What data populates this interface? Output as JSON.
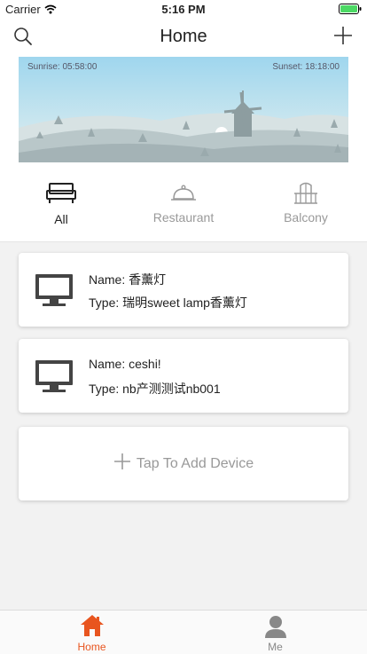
{
  "status_bar": {
    "carrier": "Carrier",
    "time": "5:16 PM"
  },
  "header": {
    "title": "Home",
    "icons": [
      "search-icon",
      "plus-icon"
    ]
  },
  "banner": {
    "sunrise": "Sunrise: 05:58:00",
    "sunset": "Sunset: 18:18:00"
  },
  "tabs": [
    {
      "label": "All",
      "icon": "sofa-icon",
      "active": true
    },
    {
      "label": "Restaurant",
      "icon": "cloche-icon",
      "active": false
    },
    {
      "label": "Balcony",
      "icon": "balcony-icon",
      "active": false
    }
  ],
  "devices": [
    {
      "name": "Name: 香薰灯",
      "type": "Type: 瑞明sweet lamp香薰灯",
      "icon": "monitor-icon"
    },
    {
      "name": "Name: ceshi!",
      "type": "Type: nb产测测试nb001",
      "icon": "monitor-icon"
    }
  ],
  "add_device": {
    "label": "Tap To Add Device"
  },
  "bottom_tabs": [
    {
      "label": "Home",
      "icon": "home-icon",
      "active": true
    },
    {
      "label": "Me",
      "icon": "person-icon",
      "active": false
    }
  ],
  "colors": {
    "accent": "#e8551f",
    "active_text": "#222222",
    "inactive_text": "#999999",
    "background": "#f2f2f2"
  }
}
